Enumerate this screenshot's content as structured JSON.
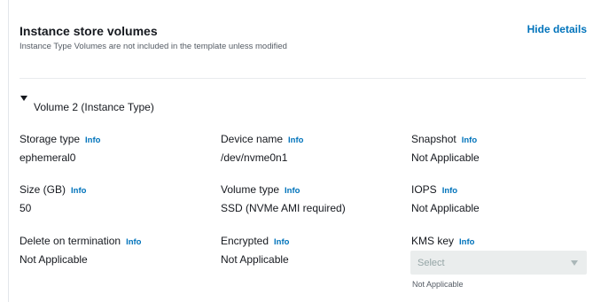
{
  "section": {
    "title": "Instance store volumes",
    "subtitle": "Instance Type Volumes are not included in the template unless modified",
    "hide_details_label": "Hide details"
  },
  "volume": {
    "title": "Volume 2 (Instance Type)",
    "expanded": true,
    "info_label": "Info",
    "fields": {
      "storage_type": {
        "label": "Storage type",
        "value": "ephemeral0"
      },
      "device_name": {
        "label": "Device name",
        "value": "/dev/nvme0n1"
      },
      "snapshot": {
        "label": "Snapshot",
        "value": "Not Applicable"
      },
      "size": {
        "label": "Size (GB)",
        "value": "50"
      },
      "volume_type": {
        "label": "Volume type",
        "value": "SSD (NVMe AMI required)"
      },
      "iops": {
        "label": "IOPS",
        "value": "Not Applicable"
      },
      "delete_on_termination": {
        "label": "Delete on termination",
        "value": "Not Applicable"
      },
      "encrypted": {
        "label": "Encrypted",
        "value": "Not Applicable"
      },
      "kms_key": {
        "label": "KMS key",
        "select_placeholder": "Select",
        "hint": "Not Applicable",
        "disabled": true
      }
    }
  },
  "colors": {
    "link": "#0073bb",
    "text": "#16191f",
    "muted": "#545b64",
    "disabled_bg": "#eaeded"
  }
}
